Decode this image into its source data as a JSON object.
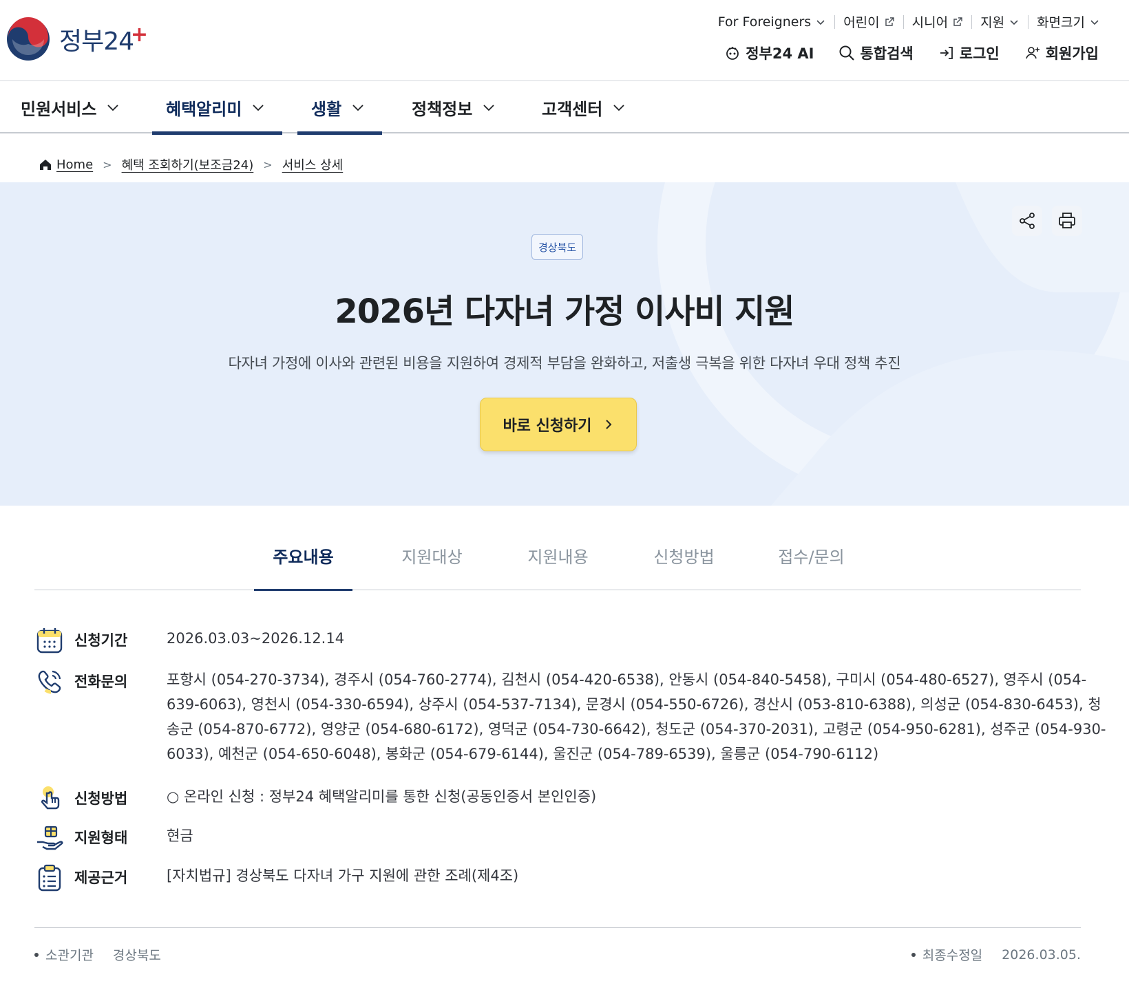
{
  "header": {
    "logo_text": "정부24",
    "util_links": [
      {
        "label": "For Foreigners",
        "icon": "chevron-down-icon"
      },
      {
        "label": "어린이",
        "icon": "external-link-icon"
      },
      {
        "label": "시니어",
        "icon": "external-link-icon"
      },
      {
        "label": "지원",
        "icon": "chevron-down-icon"
      },
      {
        "label": "화면크기",
        "icon": "chevron-down-icon"
      }
    ],
    "main_buttons": [
      {
        "label": "정부24 AI",
        "icon": "ai-bot-icon"
      },
      {
        "label": "통합검색",
        "icon": "search-icon"
      },
      {
        "label": "로그인",
        "icon": "login-icon"
      },
      {
        "label": "회원가입",
        "icon": "add-user-icon"
      }
    ]
  },
  "gnb": {
    "items": [
      {
        "label": "민원서비스",
        "active": false
      },
      {
        "label": "혜택알리미",
        "active": true
      },
      {
        "label": "생활",
        "active": true
      },
      {
        "label": "정책정보",
        "active": false
      },
      {
        "label": "고객센터",
        "active": false
      }
    ]
  },
  "breadcrumb": [
    "Home",
    "혜택 조회하기(보조금24)",
    "서비스 상세"
  ],
  "hero": {
    "badge": "경상북도",
    "title": "2026년 다자녀 가정 이사비 지원",
    "description": "다자녀 가정에 이사와 관련된 비용을 지원하여 경제적 부담을 완화하고, 저출생 극복을 위한 다자녀 우대 정책 추진",
    "apply_label": "바로 신청하기",
    "actions": [
      "share-icon",
      "print-icon"
    ]
  },
  "tabs": [
    {
      "label": "주요내용",
      "active": true
    },
    {
      "label": "지원대상",
      "active": false
    },
    {
      "label": "지원내용",
      "active": false
    },
    {
      "label": "신청방법",
      "active": false
    },
    {
      "label": "접수/문의",
      "active": false
    }
  ],
  "info": [
    {
      "label": "신청기간",
      "icon": "calendar-icon",
      "value": "2026.03.03~2026.12.14"
    },
    {
      "label": "전화문의",
      "icon": "phone-icon",
      "value": "포항시 (054-270-3734), 경주시 (054-760-2774), 김천시 (054-420-6538), 안동시 (054-840-5458), 구미시 (054-480-6527), 영주시 (054-639-6063), 영천시 (054-330-6594), 상주시 (054-537-7134), 문경시 (054-550-6726), 경산시 (053-810-6388), 의성군 (054-830-6453), 청송군 (054-870-6772), 영양군 (054-680-6172), 영덕군 (054-730-6642), 청도군 (054-370-2031), 고령군 (054-950-6281), 성주군 (054-930-6033), 예천군 (054-650-6048), 봉화군 (054-679-6144), 울진군 (054-789-6539), 울릉군 (054-790-6112)"
    },
    {
      "label": "신청방법",
      "icon": "hand-touch-icon",
      "value": "○ 온라인 신청 : 정부24 혜택알리미를 통한 신청(공동인증서 본인인증)"
    },
    {
      "label": "지원형태",
      "icon": "hand-gift-icon",
      "value": "현금"
    },
    {
      "label": "제공근거",
      "icon": "clipboard-list-icon",
      "value": "[자치법규] 경상북도 다자녀 가구 지원에 관한 조례(제4조)"
    }
  ],
  "meta": {
    "agency_label": "소관기관",
    "agency_value": "경상북도",
    "updated_label": "최종수정일",
    "updated_value": "2026.03.05."
  },
  "colors": {
    "primary_navy": "#1f3c6e",
    "hero_bg": "#e6eefa",
    "apply_yellow": "#fbe06c",
    "brand_red": "#d3303a"
  }
}
